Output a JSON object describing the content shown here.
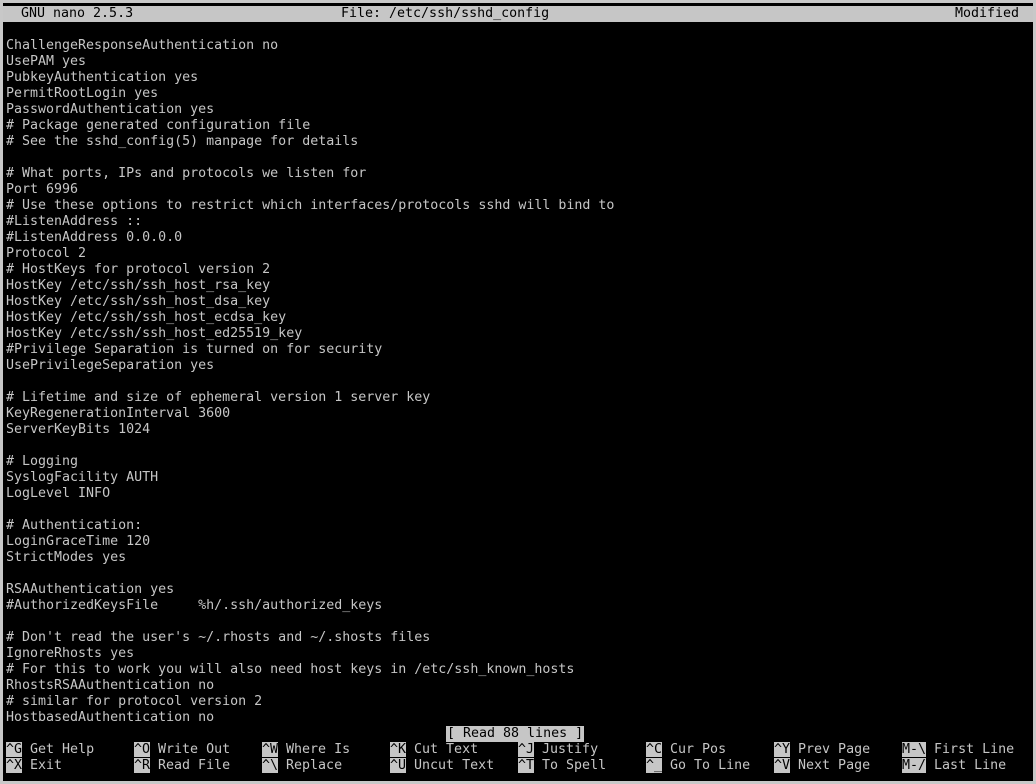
{
  "titlebar": {
    "app": "GNU nano 2.5.3",
    "file": "File: /etc/ssh/sshd_config",
    "state": "Modified"
  },
  "lines": [
    "ChallengeResponseAuthentication no",
    "UsePAM yes",
    "PubkeyAuthentication yes",
    "PermitRootLogin yes",
    "PasswordAuthentication yes",
    "# Package generated configuration file",
    "# See the sshd_config(5) manpage for details",
    "",
    "# What ports, IPs and protocols we listen for",
    "Port 6996",
    "# Use these options to restrict which interfaces/protocols sshd will bind to",
    "#ListenAddress ::",
    "#ListenAddress 0.0.0.0",
    "Protocol 2",
    "# HostKeys for protocol version 2",
    "HostKey /etc/ssh/ssh_host_rsa_key",
    "HostKey /etc/ssh/ssh_host_dsa_key",
    "HostKey /etc/ssh/ssh_host_ecdsa_key",
    "HostKey /etc/ssh/ssh_host_ed25519_key",
    "#Privilege Separation is turned on for security",
    "UsePrivilegeSeparation yes",
    "",
    "# Lifetime and size of ephemeral version 1 server key",
    "KeyRegenerationInterval 3600",
    "ServerKeyBits 1024",
    "",
    "# Logging",
    "SyslogFacility AUTH",
    "LogLevel INFO",
    "",
    "# Authentication:",
    "LoginGraceTime 120",
    "StrictModes yes",
    "",
    "RSAAuthentication yes",
    "#AuthorizedKeysFile     %h/.ssh/authorized_keys",
    "",
    "# Don't read the user's ~/.rhosts and ~/.shosts files",
    "IgnoreRhosts yes",
    "# For this to work you will also need host keys in /etc/ssh_known_hosts",
    "RhostsRSAAuthentication no",
    "# similar for protocol version 2",
    "HostbasedAuthentication no"
  ],
  "status_message": "[ Read 88 lines ]",
  "shortcuts": {
    "row1": [
      {
        "key": "^G",
        "label": "Get Help"
      },
      {
        "key": "^O",
        "label": "Write Out"
      },
      {
        "key": "^W",
        "label": "Where Is"
      },
      {
        "key": "^K",
        "label": "Cut Text"
      },
      {
        "key": "^J",
        "label": "Justify"
      },
      {
        "key": "^C",
        "label": "Cur Pos"
      },
      {
        "key": "^Y",
        "label": "Prev Page"
      },
      {
        "key": "M-\\",
        "label": "First Line"
      }
    ],
    "row2": [
      {
        "key": "^X",
        "label": "Exit"
      },
      {
        "key": "^R",
        "label": "Read File"
      },
      {
        "key": "^\\",
        "label": "Replace"
      },
      {
        "key": "^U",
        "label": "Uncut Text"
      },
      {
        "key": "^T",
        "label": "To Spell"
      },
      {
        "key": "^_",
        "label": "Go To Line"
      },
      {
        "key": "^V",
        "label": "Next Page"
      },
      {
        "key": "M-/",
        "label": "Last Line"
      }
    ]
  }
}
